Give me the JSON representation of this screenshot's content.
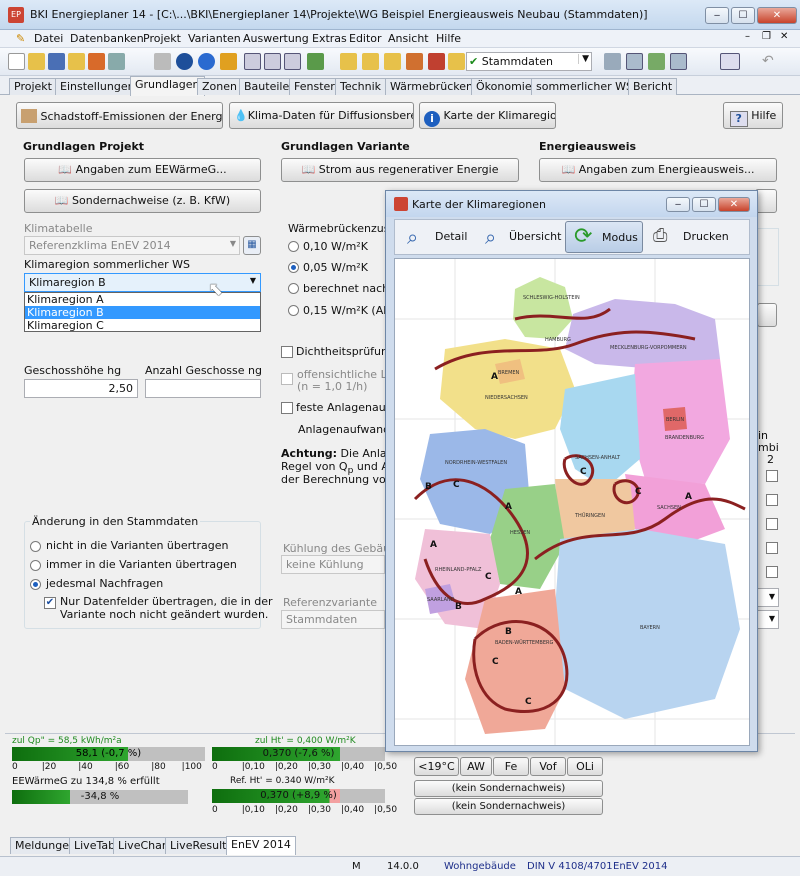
{
  "window": {
    "title": "BKI Energieplaner 14 - [C:\\...\\BKI\\Energieplaner 14\\Projekte\\WG Beispiel Energieausweis Neubau (Stammdaten)]",
    "minimize": "‒",
    "maximize": "☐",
    "close": "✕"
  },
  "menu": [
    "Datei",
    "Datenbanken",
    "Projekt",
    "Varianten",
    "Auswertung",
    "Extras",
    "Editor",
    "Ansicht",
    "Hilfe"
  ],
  "mdi": {
    "min": "–",
    "restore": "❐",
    "close": "✕"
  },
  "toolbar": {
    "variant_select": "Stammdaten"
  },
  "tabs": [
    "Projekt",
    "Einstellungen",
    "Grundlagen",
    "Zonen",
    "Bauteile",
    "Fenster",
    "Technik",
    "Wärmebrücken",
    "Ökonomie",
    "sommerlicher WS",
    "Bericht"
  ],
  "actions": {
    "emissions": "Schadstoff-Emissionen der Energieträger",
    "climate": "Klima-Daten für Diffusionsberechnung",
    "map": "Karte der Klimaregionen",
    "help": "Hilfe"
  },
  "left": {
    "section": "Grundlagen Projekt",
    "btn_eew": "Angaben zum EEWärmeG...",
    "btn_sonder": "Sondernachweise (z. B. KfW)",
    "klimatabelle_label": "Klimatabelle",
    "klimatabelle_value": "Referenzklima EnEV 2014",
    "klimaregion_label": "Klimaregion sommerlicher WS",
    "klimaregion_value": "Klimaregion B",
    "options": [
      "Klimaregion A",
      "Klimaregion B",
      "Klimaregion C"
    ],
    "geschoss_label": "Geschosshöhe hg",
    "geschoss_value": "2,50",
    "anzahl_label": "Anzahl Geschosse ng",
    "anzahl_value": ""
  },
  "aenderung": {
    "title": "Änderung in den Stammdaten",
    "r1": "nicht in die Varianten übertragen",
    "r2": "immer in die Varianten übertragen",
    "r3": "jedesmal Nachfragen",
    "cb1": "Nur Datenfelder übertragen, die in der",
    "cb2": "Variante noch nicht geändert wurden."
  },
  "mid": {
    "section": "Grundlagen Variante",
    "btn_strom": "Strom aus regenerativer Energie",
    "wbz_label": "Wärmebrückenzusc",
    "w1": "0,10 W/m²K",
    "w2": "0,05 W/m²K",
    "w3": "berechnet nach",
    "w4": "0,15 W/m²K (Al",
    "dicht": "Dichtheitsprüfung",
    "offen1": "offensichtliche Lu",
    "offen2": "(n = 1,0 1/h)",
    "feste": "feste Anlagenaufw",
    "anlagen": "Anlagenaufwands",
    "achtung_bold": "Achtung:",
    "achtung1": " Die Anlage",
    "achtung2": "Regel von Q",
    "achtung2b": "p",
    "achtung2c": " und A",
    "achtung2d": "N",
    "achtung3": "der Berechnung von",
    "kuehlung_label": "Kühlung des Gebäud",
    "kuehlung_value": "keine Kühlung",
    "ref_label": "Referenzvariante",
    "ref_value": "Stammdaten"
  },
  "right": {
    "section": "Energieausweis",
    "btn_energie": "Angaben zum Energieausweis...",
    "partial_in": "in",
    "partial_mbi": "mbi",
    "partial_2": "2"
  },
  "popup": {
    "title": "Karte der Klimaregionen",
    "detail": "Detail",
    "uebersicht": "Übersicht",
    "modus": "Modus",
    "drucken": "Drucken",
    "cities": [
      "SCHLESWIG-HOLSTEIN",
      "HAMBURG",
      "MECKLENBURG-VORPOMMERN",
      "BREMEN",
      "NIEDERSACHSEN",
      "BERLIN",
      "BRANDENBURG",
      "SACHSEN-ANHALT",
      "NORDRHEIN-WESTFALEN",
      "SACHSEN",
      "HESSEN",
      "THÜRINGEN",
      "RHEINLAND-PFALZ",
      "SAARLAND",
      "BAYERN",
      "BADEN-WÜRTTEMBERG"
    ]
  },
  "bottom": {
    "qp_label": "zul Qp\" = 58,5 kWh/m²a",
    "qp_value": "58,1 (-0,7 %)",
    "ht_label": "zul Ht' = 0,400 W/m²K",
    "ht_value": "0,370 (-7,6 %)",
    "eew_label": "EEWärmeG zu 134,8 % erfüllt",
    "eew_value": "-34,8 %",
    "ref_label": "Ref. Ht' = 0.340 W/m²K",
    "ref_value": "0,370 (+8,9 %)",
    "scale1": [
      "0",
      "|20",
      "|40",
      "|60",
      "|80",
      "|100"
    ],
    "scale2": [
      "0",
      "|0,10",
      "|0,20",
      "|0,30",
      "|0,40",
      "|0,50"
    ],
    "btns": [
      "<19°C",
      "AW",
      "Fe",
      "Vof",
      "OLi"
    ],
    "sonder1": "(kein Sondernachweis)",
    "sonder2": "(kein Sondernachweis)"
  },
  "bottom_tabs": [
    "Meldungen",
    "LiveTab",
    "LiveChart",
    "LiveResults",
    "EnEV 2014"
  ],
  "status": {
    "m": "M",
    "version": "14.0.0",
    "type": "Wohngebäude",
    "din": "DIN V 4108/4701",
    "enev": "EnEV 2014"
  },
  "colors": {
    "accent": "#3399ff",
    "green": "#1f8a1f",
    "border": "#8b2020"
  }
}
